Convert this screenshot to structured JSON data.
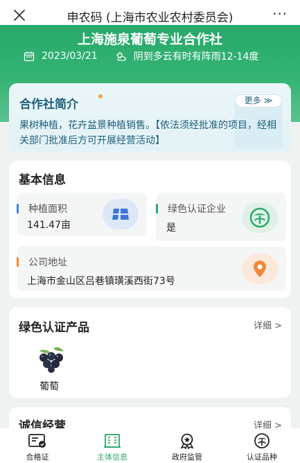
{
  "topbar": {
    "title": "申农码 (上海市农业农村委员会)",
    "close_icon": "close-icon",
    "more_icon": "more-icon",
    "more_glyph": "···"
  },
  "header": {
    "org_name": "上海施泉葡萄专业合作社",
    "date": "2023/03/21",
    "weather": "阴到多云有时有阵雨12-14度",
    "bg_color": "#28a96a"
  },
  "intro": {
    "title": "合作社简介",
    "more_label": "更多 ≫",
    "text": "果树种植，花卉盆景种植销售。【依法须经批准的项目，经相关部门批准后方可开展经营活动】",
    "text_color": "#1e5f7a"
  },
  "basic": {
    "title": "基本信息",
    "area_label": "种植面积",
    "area_value": "141.47亩",
    "green_label": "绿色认证企业",
    "green_value": "是",
    "address_label": "公司地址",
    "address_value": "上海市金山区吕巷镇璜溪西街73号"
  },
  "products": {
    "title": "绿色认证产品",
    "detail_label": "详细 >",
    "items": [
      {
        "name": "葡萄",
        "icon": "grape-icon"
      }
    ]
  },
  "integrity": {
    "title": "诚信经营",
    "detail_label": "详细 >"
  },
  "bottom_nav": [
    {
      "label": "合格证",
      "icon": "certificate-icon",
      "active": false
    },
    {
      "label": "主体信息",
      "icon": "building-icon",
      "active": true
    },
    {
      "label": "政府监管",
      "icon": "badge-icon",
      "active": false
    },
    {
      "label": "认证品种",
      "icon": "green-cert-icon",
      "active": false
    }
  ],
  "colors": {
    "accent": "#2aa86a",
    "bar_blue": "#4a7fd4",
    "bar_green": "#2aa86a",
    "bar_orange": "#f0883a"
  }
}
